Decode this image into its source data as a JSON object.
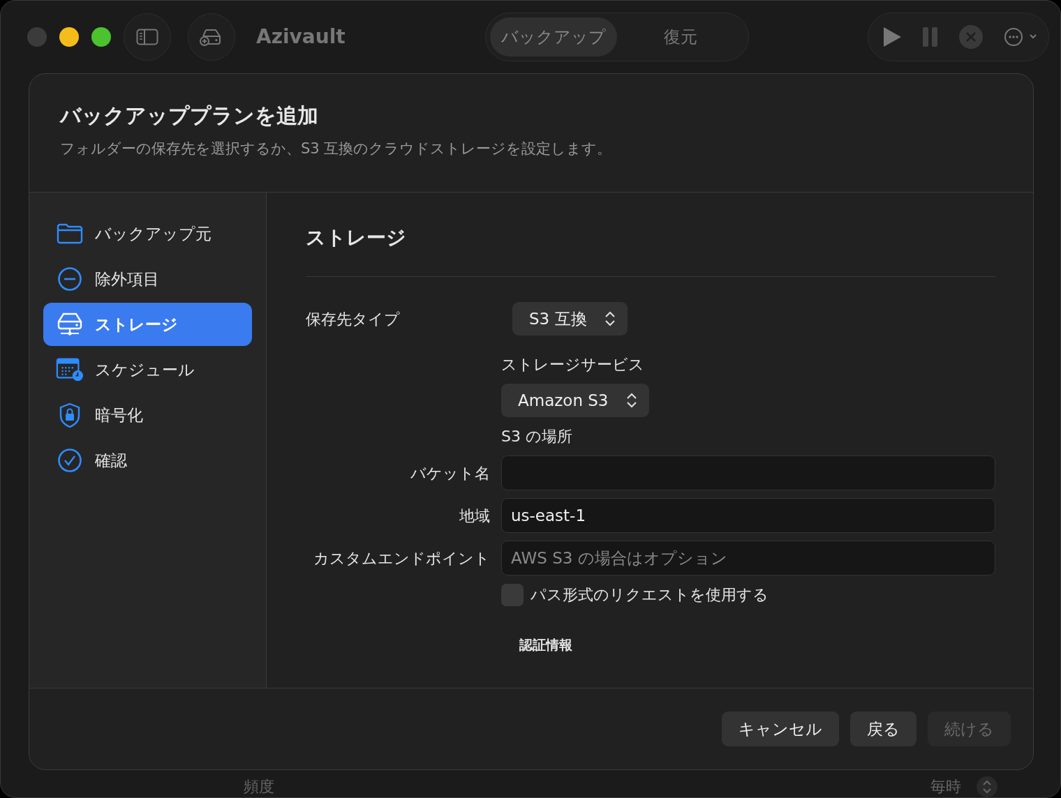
{
  "window": {
    "title": "Azivault"
  },
  "mode_tabs": [
    {
      "label": "バックアップ",
      "selected": true
    },
    {
      "label": "復元",
      "selected": false
    }
  ],
  "sheet": {
    "title": "バックアッププランを追加",
    "subtitle": "フォルダーの保存先を選択するか、S3 互換のクラウドストレージを設定します。",
    "steps": [
      {
        "label": "バックアップ元",
        "selected": false
      },
      {
        "label": "除外項目",
        "selected": false
      },
      {
        "label": "ストレージ",
        "selected": true
      },
      {
        "label": "スケジュール",
        "selected": false
      },
      {
        "label": "暗号化",
        "selected": false
      },
      {
        "label": "確認",
        "selected": false
      }
    ],
    "section_title": "ストレージ",
    "form": [
      {
        "kind": "select",
        "label": "保存先タイプ",
        "value": "S3 互換"
      },
      {
        "kind": "heading",
        "label": "ストレージサービス"
      },
      {
        "kind": "stacked-select",
        "value": "Amazon S3"
      },
      {
        "kind": "heading",
        "label": "S3 の場所"
      },
      {
        "kind": "field",
        "label": "バケット名"
      },
      {
        "kind": "field",
        "label": "地域",
        "value": "us-east-1"
      },
      {
        "kind": "field",
        "label": "カスタムエンドポイント",
        "placeholder": "AWS S3 の場合はオプション"
      },
      {
        "kind": "checkbox",
        "label": "パス形式のリクエストを使用する",
        "checked": false
      },
      {
        "kind": "subheading",
        "label": "認証情報"
      }
    ],
    "buttons": [
      {
        "label": "キャンセル",
        "disabled": false
      },
      {
        "label": "戻る",
        "disabled": false
      },
      {
        "label": "続ける",
        "disabled": true
      }
    ]
  },
  "background": {
    "label": "頻度",
    "value": "毎時"
  }
}
